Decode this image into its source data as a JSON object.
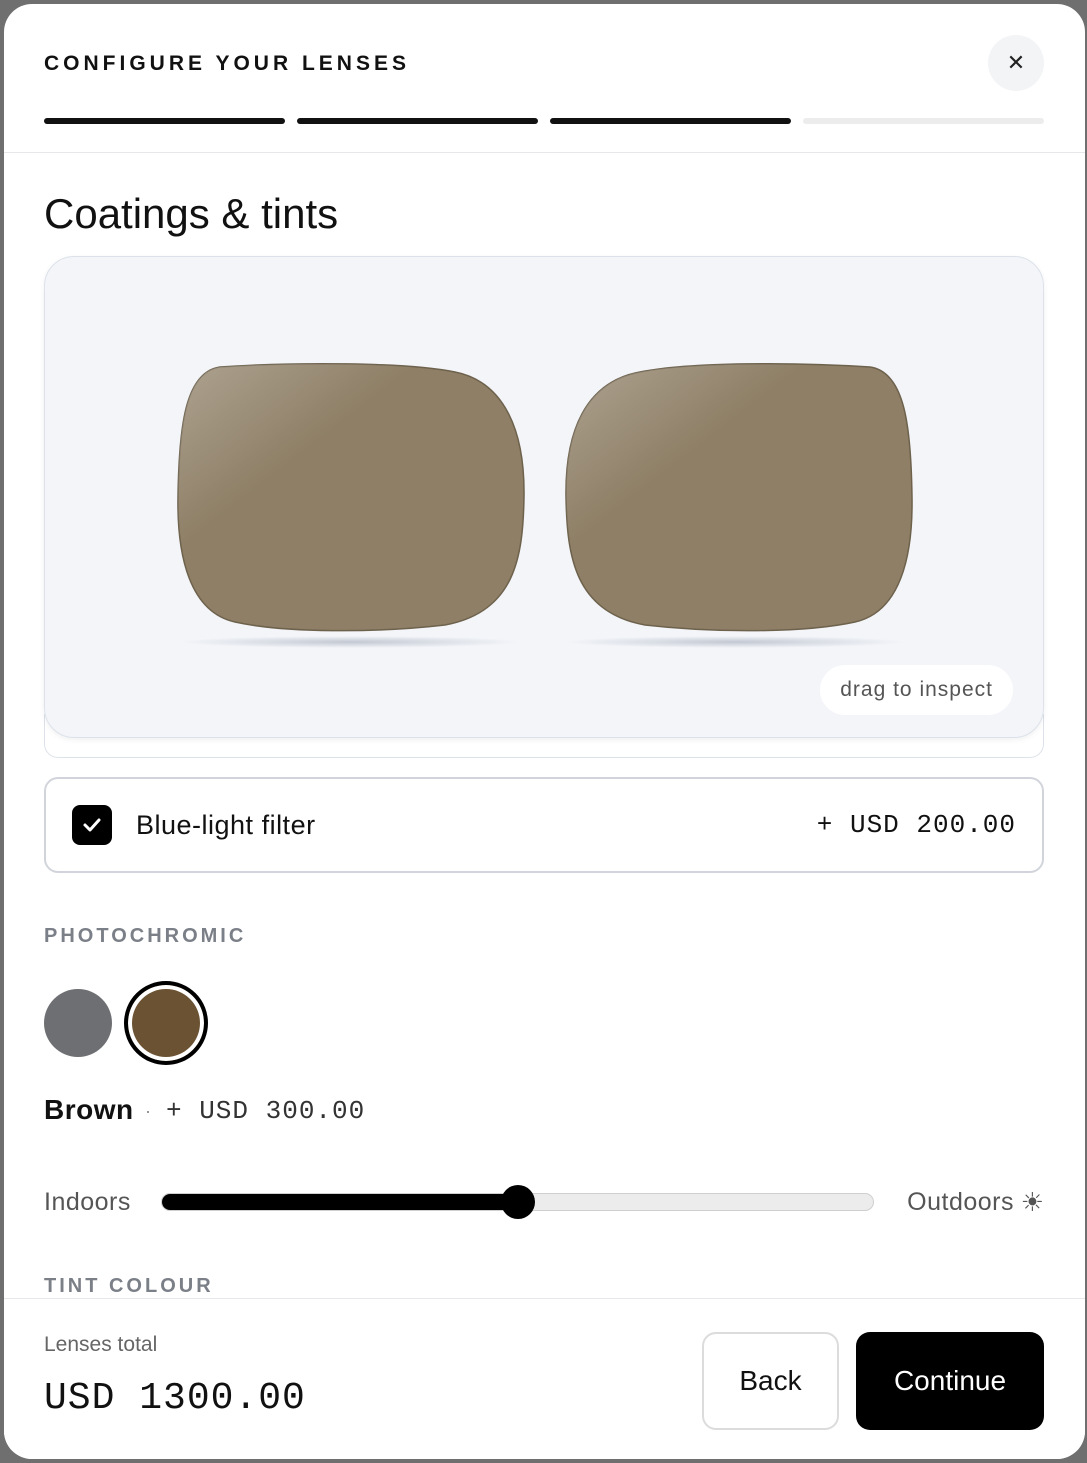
{
  "header": {
    "title": "CONFIGURE YOUR LENSES",
    "close_icon": "close-icon",
    "steps_total": 4,
    "steps_completed": 3
  },
  "section": {
    "title": "Coatings & tints"
  },
  "preview": {
    "hint": "drag to inspect",
    "lens_color": "#8e7f66"
  },
  "blue_light": {
    "label": "Blue-light filter",
    "price": "+ USD 200.00",
    "checked": true
  },
  "photochromic": {
    "label": "PHOTOCHROMIC",
    "swatches": [
      {
        "name": "Grey",
        "color": "#6e6f72",
        "selected": false
      },
      {
        "name": "Brown",
        "color": "#6b5232",
        "selected": true
      }
    ],
    "selected_name": "Brown",
    "selected_separator": "·",
    "selected_price": "+ USD 300.00"
  },
  "slider": {
    "left_label": "Indoors",
    "right_label": "Outdoors",
    "right_icon": "sun-icon",
    "value": 0.5
  },
  "tint": {
    "label": "TINT COLOUR"
  },
  "footer": {
    "total_label": "Lenses total",
    "total_value": "USD 1300.00",
    "back_label": "Back",
    "continue_label": "Continue"
  }
}
